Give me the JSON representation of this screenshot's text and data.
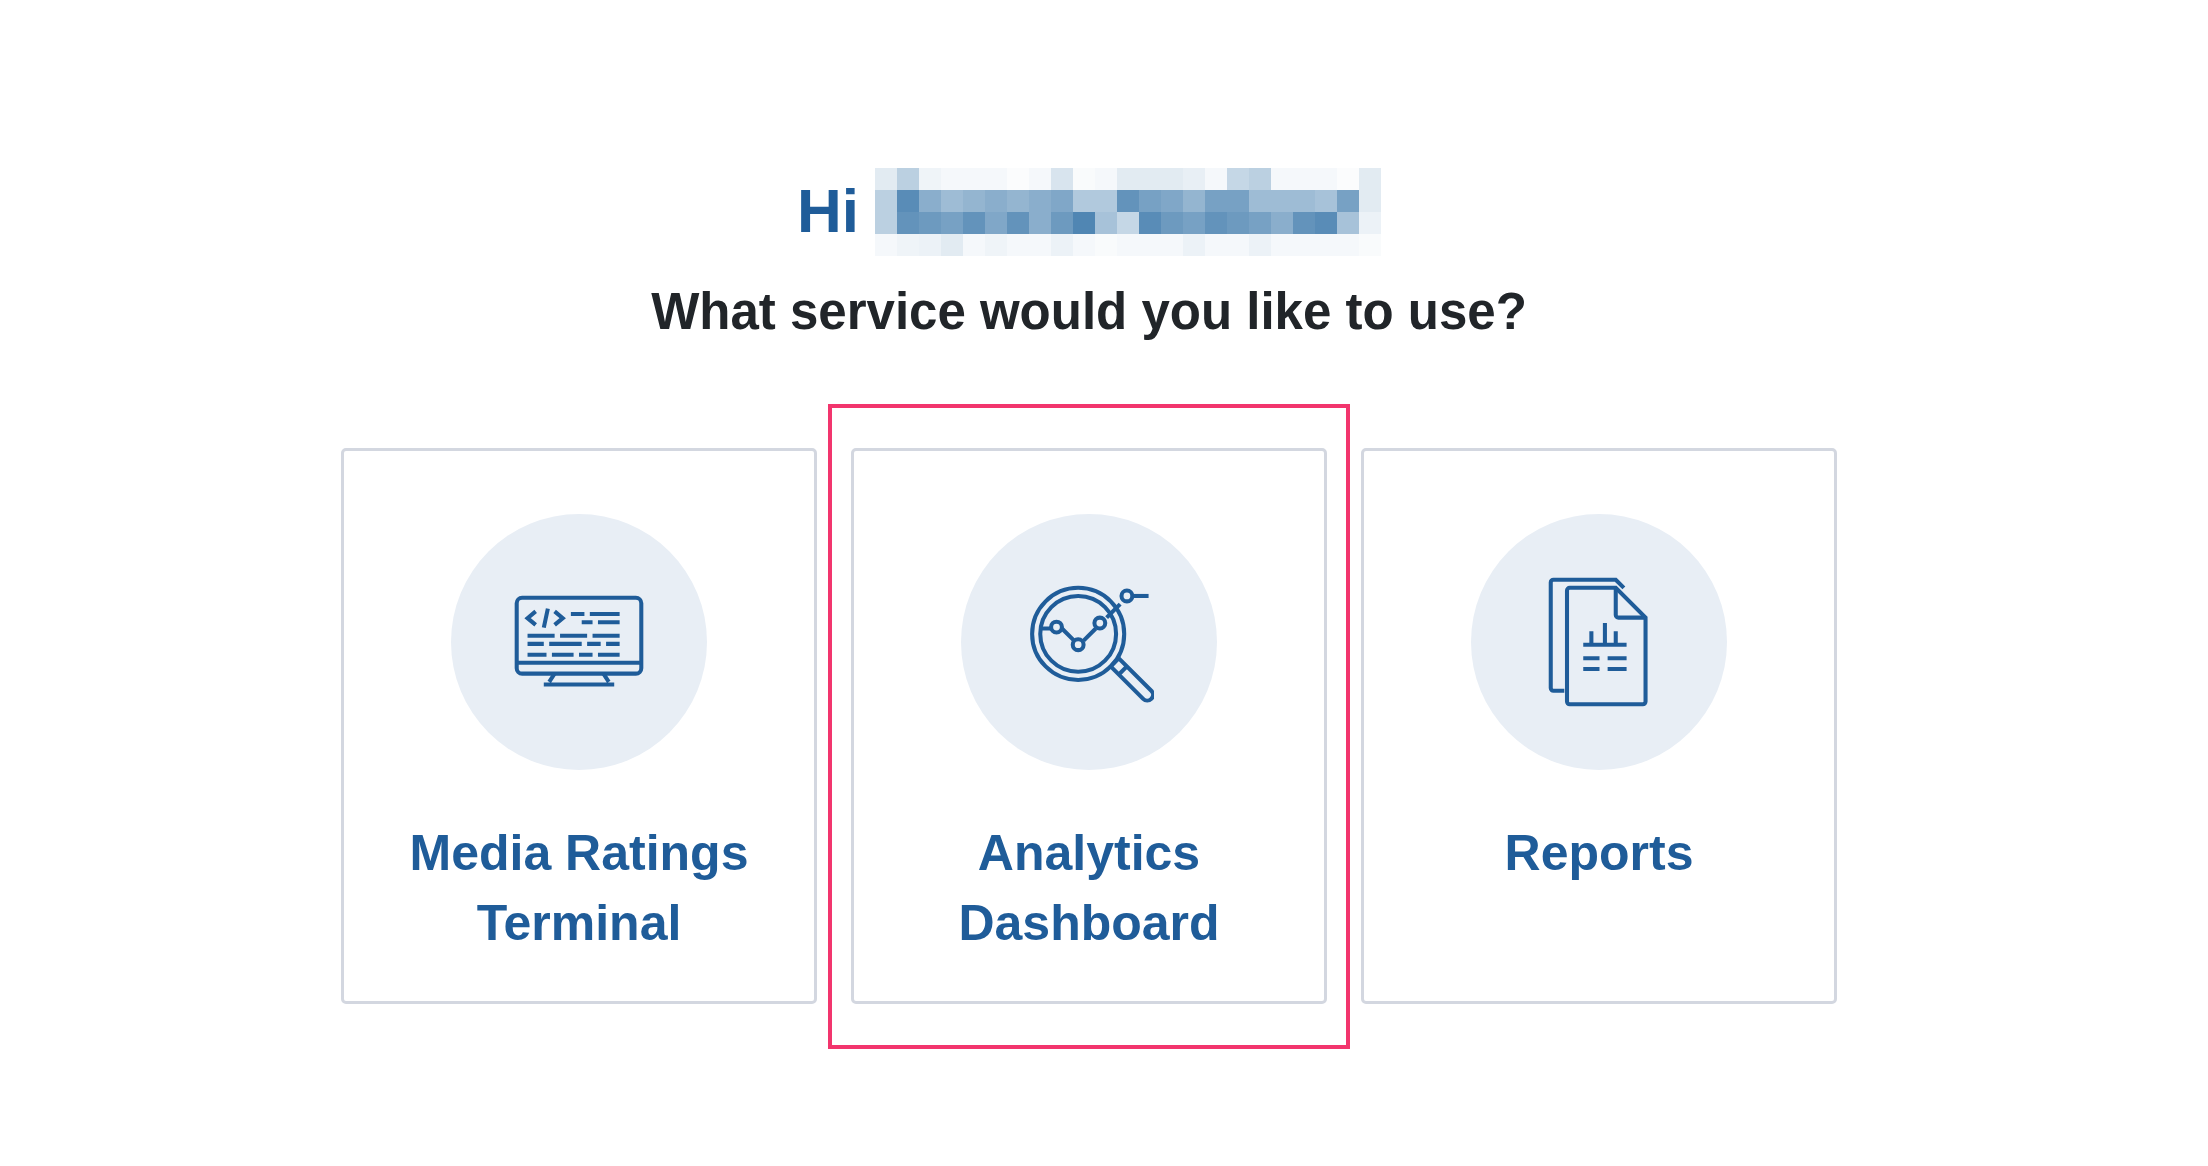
{
  "greeting": "Hi",
  "question": "What service would you like to use?",
  "services": [
    {
      "title": "Media Ratings Terminal",
      "kind": "terminal",
      "selected": false
    },
    {
      "title": "Analytics Dashboard",
      "kind": "analytics",
      "selected": true
    },
    {
      "title": "Reports",
      "kind": "reports",
      "selected": false
    }
  ]
}
